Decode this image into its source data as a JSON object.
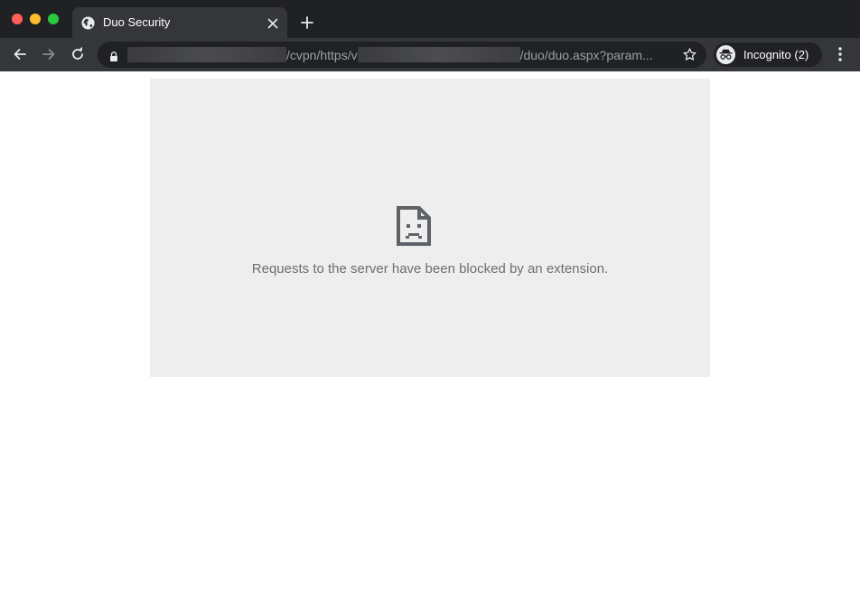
{
  "tab": {
    "title": "Duo Security",
    "favicon": "globe-icon"
  },
  "toolbar": {
    "url": {
      "segment1": "/cvpn/https/v",
      "segment2": "/duo/duo.aspx?param..."
    },
    "incognito_label": "Incognito (2)"
  },
  "page": {
    "error_icon": "sad-document-icon",
    "error_message": "Requests to the server have been blocked by an extension."
  },
  "colors": {
    "chrome_dark": "#202124",
    "toolbar": "#35363a",
    "content_bg": "#eeeeee",
    "error_text": "#6e6e6e"
  }
}
